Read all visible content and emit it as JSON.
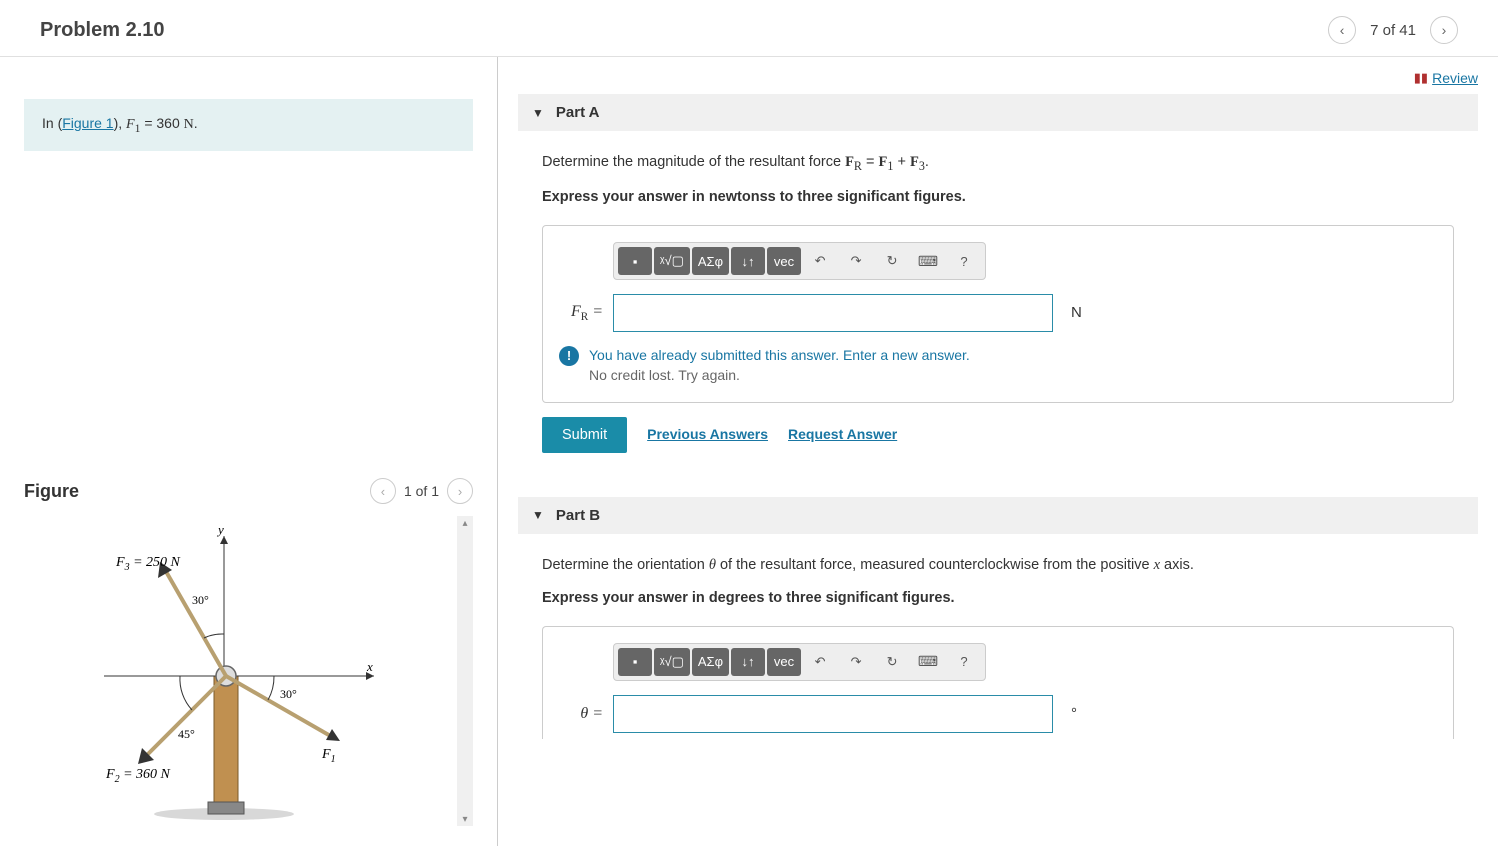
{
  "header": {
    "title": "Problem 2.10",
    "counter": "7 of 41"
  },
  "review": "Review",
  "problem_intro": {
    "prefix": "In (",
    "figlink": "Figure 1",
    "suffix": "), ",
    "var": "F",
    "sub": "1",
    "eq": " = 360 ",
    "unit": "N",
    "end": "."
  },
  "figure": {
    "title": "Figure",
    "counter": "1 of 1",
    "labels": {
      "yaxis": "y",
      "xaxis": "x",
      "f3": "F₃ = 250 N",
      "f2": "F₂ = 360 N",
      "f1": "F₁",
      "ang30a": "30°",
      "ang30b": "30°",
      "ang45": "45°"
    }
  },
  "partA": {
    "title": "Part A",
    "prompt_pre": "Determine the magnitude of the resultant force ",
    "prompt_mid": " = ",
    "prompt_plus": " + ",
    "prompt_end": ".",
    "instruction": "Express your answer in newtonss to three significant figures.",
    "label_var": "F",
    "label_sub": "R",
    "label_eq": " =",
    "unit": "N",
    "feedback_line1": "You have already submitted this answer. Enter a new answer.",
    "feedback_line2": "No credit lost. Try again.",
    "submit": "Submit",
    "prev": "Previous Answers",
    "request": "Request Answer"
  },
  "partB": {
    "title": "Part B",
    "prompt_pre": "Determine the orientation ",
    "prompt_theta": "θ",
    "prompt_post": " of the resultant force, measured counterclockwise from the positive ",
    "prompt_axis": "x",
    "prompt_end": " axis.",
    "instruction": "Express your answer in degrees to three significant figures.",
    "label": "θ =",
    "unit": "°"
  },
  "toolbar": {
    "t1": "▪",
    "t2": "ᵡ√▢",
    "t3": "ΑΣφ",
    "t4": "↓↑",
    "t5": "vec",
    "undo": "↶",
    "redo": "↷",
    "reset": "↻",
    "keyboard": "⌨",
    "help": "?"
  }
}
